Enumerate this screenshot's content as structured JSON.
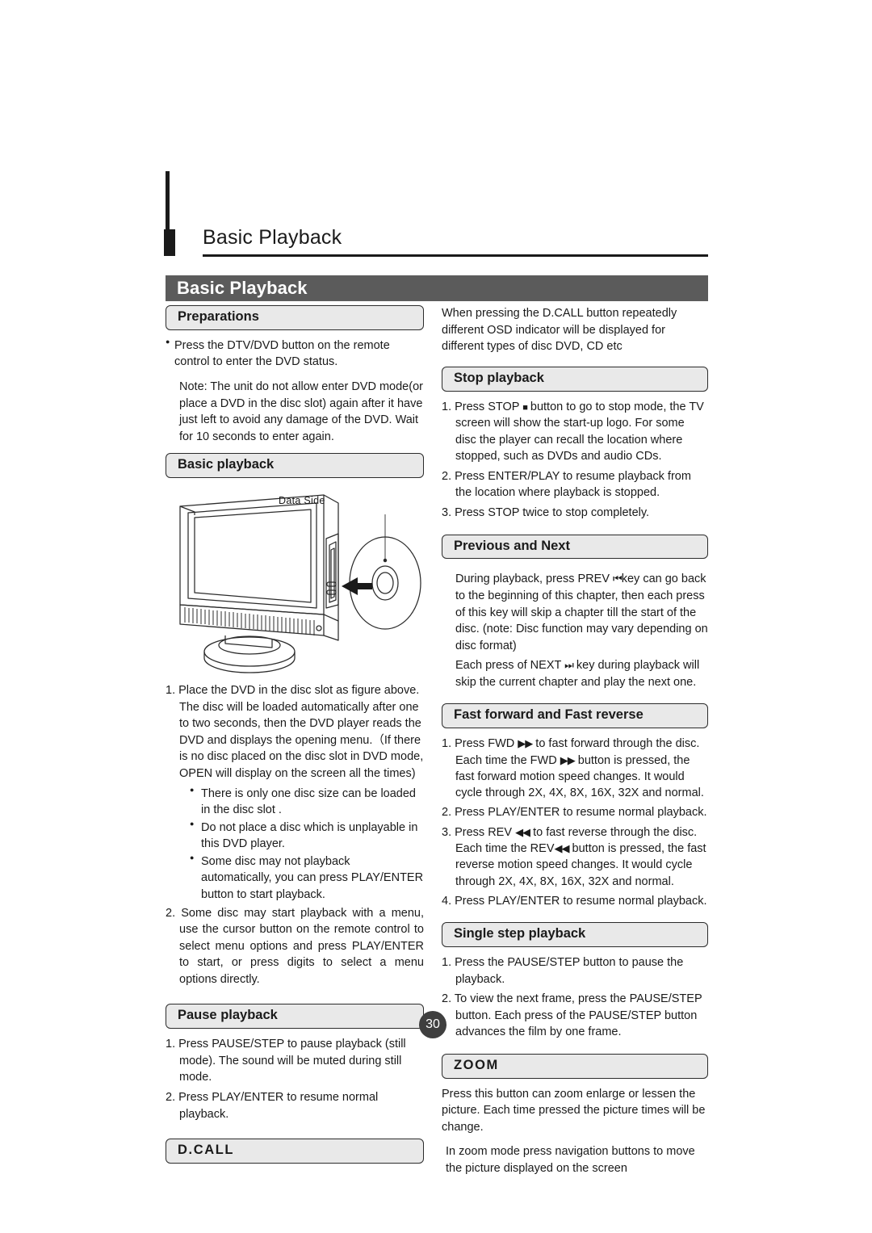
{
  "page": {
    "running_header_title": "Basic Playback",
    "chapter_banner_title": "Basic Playback",
    "page_number": "30"
  },
  "left_column": {
    "preparations": {
      "heading": "Preparations",
      "bullet": "Press the DTV/DVD button on the remote control to enter the DVD status.",
      "note": "Note: The unit do not allow enter DVD mode(or place a DVD in the disc slot) again after it have just left to avoid any damage of the DVD. Wait for 10 seconds to enter again."
    },
    "basic_playback": {
      "heading": "Basic playback",
      "figure": {
        "label": "Data Side",
        "alt_name": "tv-with-dvd-disc-diagram"
      },
      "step_1": "1. Place the DVD in the disc slot as figure above. The disc will be loaded automatically after one to two seconds, then the DVD player reads the DVD and displays the opening menu.（If there is no disc placed on the disc slot  in DVD mode, OPEN will display on the screen all the times)",
      "sub_bullets": [
        "There is only one disc size can be loaded in the disc slot .",
        "Do not place  a disc which is unplayable  in this DVD player.",
        "Some disc may not  playback  automatically, you  can  press PLAY/ENTER button to start playback."
      ],
      "step_2": "2. Some  disc  may start  playback  with  a menu, use  the  cursor button on the remote control to select  menu  options  and press PLAY/ENTER to start,  or  press  digits  to  select  a  menu options directly."
    },
    "pause_playback": {
      "heading": "Pause playback",
      "step_1": "1. Press PAUSE/STEP  to pause playback (still mode). The sound will be muted during still mode.",
      "step_2": "2. Press PLAY/ENTER to resume normal playback."
    },
    "d_call": {
      "heading": "D.CALL"
    }
  },
  "right_column": {
    "d_call_intro": "When pressing the D.CALL button repeatedly different OSD indicator will be displayed for different types of disc DVD, CD etc",
    "stop_playback": {
      "heading": "Stop playback",
      "step_1_pre": "1. Press STOP",
      "step_1_glyph": "■",
      "step_1_post": "button to go to stop mode, the TV screen will show the start-up logo. For some disc the player can recall the location where stopped, such as DVDs and audio CDs.",
      "step_2": "2. Press ENTER/PLAY to resume  playback from the location where playback is stopped.",
      "step_3": "3. Press STOP twice to stop completely."
    },
    "previous_next": {
      "heading": "Previous and Next",
      "para_1_pre": "During playback, press PREV",
      "para_1_glyph": "⏮",
      "para_1_post": "key can go back to the beginning of this chapter, then each press of this key will skip a chapter till the start of the disc. (note: Disc function may vary depending on disc format)",
      "para_2_pre": "Each press of NEXT",
      "para_2_glyph": "⏭",
      "para_2_post": "key during playback will skip the current chapter and play the next one."
    },
    "fast_forward_reverse": {
      "heading": "Fast forward and Fast reverse",
      "step_1_a": "1. Press FWD",
      "step_1_glyph": "▶▶",
      "step_1_b": "to fast forward through the disc.",
      "step_1_c": "Each time the FWD",
      "step_1_d": "button is pressed, the fast forward motion speed changes. It would cycle through 2X, 4X, 8X, 16X, 32X and normal.",
      "step_2": "2. Press PLAY/ENTER to resume normal playback.",
      "step_3_a": "3. Press REV",
      "step_3_glyph": "◀◀",
      "step_3_b": "to fast reverse through the disc.",
      "step_3_c": "Each time the REV",
      "step_3_d": "button is pressed, the fast reverse motion speed changes. It would cycle through 2X, 4X, 8X, 16X, 32X and normal.",
      "step_4": "4. Press  PLAY/ENTER  to resume normal playback."
    },
    "single_step": {
      "heading": "Single step playback",
      "step_1": "1. Press the PAUSE/STEP button to pause the playback.",
      "step_2": "2. To view the next frame, press the PAUSE/STEP button. Each press of the PAUSE/STEP button advances the film by one frame."
    },
    "zoom": {
      "heading": "ZOOM",
      "para_1": "Press this button can zoom enlarge or lessen the picture. Each time pressed the picture times will be change.",
      "para_2": "In zoom mode press navigation buttons to move the picture displayed on the screen"
    }
  },
  "colors": {
    "banner_bg": "#5b5b5b",
    "section_box_bg": "#e9e9e9",
    "section_box_border": "#2b2b2b",
    "text": "#1a1a1a",
    "page_badge_bg": "#3f3f3f"
  }
}
